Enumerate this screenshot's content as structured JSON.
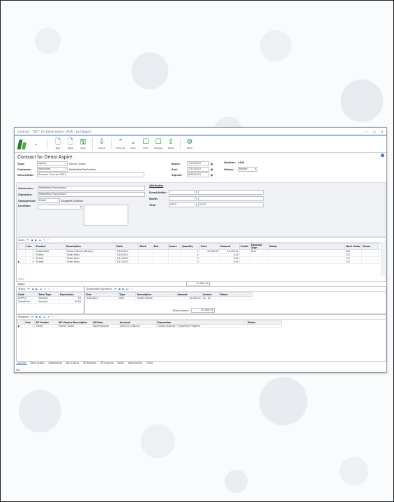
{
  "window": {
    "title": "Contract - \"007\" for Demo Aspire - ACW - Lori Bogert"
  },
  "toolbar": {
    "buttons": [
      {
        "icon": "plus-doc-icon",
        "label": "New"
      },
      {
        "icon": "doc-icon",
        "label": "Reset"
      },
      {
        "icon": "save-icon",
        "label": "Save"
      },
      {
        "icon": "import-icon",
        "label": "Import"
      },
      {
        "icon": "chevron-up-icon",
        "label": "Previous"
      },
      {
        "icon": "chevron-down-icon",
        "label": "Next"
      },
      {
        "icon": "print-icon",
        "label": "Print"
      },
      {
        "icon": "preview-icon",
        "label": "Preview"
      },
      {
        "icon": "settle-icon",
        "label": "Settle"
      },
      {
        "icon": "gear-icon",
        "label": "Stats"
      }
    ]
  },
  "contract": {
    "title": "Contract for Demo Aspire",
    "type_label": "Type:",
    "type_value": "Master",
    "subtype_value": "Interim Event",
    "customer_label": "Customer:",
    "customer_value": "MediaMax",
    "customer_value2": "MediaMax Productions",
    "description_label": "Description:",
    "description_value": "Summer Concert 2023",
    "begin_label": "Begin:",
    "begin_value": "7/10/2023",
    "end_label": "End:",
    "end_value": "7/12/2023",
    "signed_label": "Signed:",
    "signed_value": "6/30/2023",
    "number_label": "Number:",
    "number_value": "1641",
    "status_label": "Status:",
    "status_value": "Master",
    "contractor_label": "Contractor:",
    "contractor_value": "MediaMax Productions",
    "signatory_label": "Signatory:",
    "signatory_value": "MediaMax Productions",
    "salesperson_label": "Salesperson:",
    "salesperson_value": "Elliott",
    "salesperson_name": "Elizabeth Stratton",
    "location_label": "Location:",
    "attributes_label": "Attributes",
    "event_artist_label": "Event/Artist:",
    "booth_label": "Booth:",
    "year_label": "Year:",
    "year_value": "2023",
    "year_value2": "2023"
  },
  "lines": {
    "title": "Lines",
    "headers": [
      "Line",
      "Product",
      "Description",
      "Date",
      "Start",
      "End",
      "Hours",
      "Quantity",
      "Price",
      "Amount",
      "Credit",
      "Payment Type",
      "Notes",
      "Work Order",
      "Memo"
    ],
    "rows": [
      [
        "1",
        "TheatreRntl",
        "Theatre Rental (Weekly)",
        "7/10/2023",
        "",
        "",
        "",
        "1",
        "10,000.00",
        "10,000.00",
        "",
        "Rent",
        "",
        "209",
        ""
      ],
      [
        "2",
        "Tickets",
        "Ticket Sales",
        "7/10/2023",
        "",
        "",
        "",
        "0",
        "",
        "0.00",
        "",
        "",
        "",
        "210",
        ""
      ],
      [
        "3",
        "Tickets",
        "Ticket Sales",
        "7/11/2023",
        "",
        "",
        "",
        "0",
        "",
        "0.00",
        "",
        "",
        "",
        "211",
        ""
      ],
      [
        "4",
        "Tickets",
        "Ticket Sales",
        "7/12/2023",
        "",
        "",
        "",
        "0",
        "",
        "0.00",
        "",
        "",
        "",
        "212",
        ""
      ]
    ],
    "totals_label": "Totals:",
    "totals_value": "10,000.00"
  },
  "terms": {
    "title": "Terms",
    "headers": [
      "Code",
      "Data Type",
      "Expression"
    ],
    "rows": [
      [
        "BOPPCT",
        "Numeric",
        ".10"
      ],
      [
        "TicketPrice",
        "Numeric",
        "50.00"
      ]
    ]
  },
  "scheduled": {
    "title": "Scheduled Payments",
    "headers": [
      "Due",
      "Type",
      "Description",
      "Amount",
      "Invoice",
      "Memo"
    ],
    "rows": [
      [
        "3/10/2023",
        "Rent",
        "Facility Rental",
        "10,000.00",
        "10 - 42",
        ""
      ]
    ],
    "total_label": "Total Amount:",
    "total_value": "10,000.00"
  },
  "payables": {
    "title": "Payables",
    "headers": [
      "Line",
      "AP Vendor",
      "AP Vendor Description",
      "APCode",
      "Account",
      "Expression",
      "Memo"
    ],
    "rows": [
      [
        "1",
        "Tucker",
        "Rachel Tucker",
        "NonEmployee",
        "4030-01-CONCR-A",
        "Tickets.Quantity * TicketPrice * BopPct",
        ""
      ]
    ]
  },
  "bottom_tabs": [
    "Contract",
    "Work Orders",
    "Settlements",
    "AR Invoices",
    "AR Receipts",
    "AP Invoices",
    "Notes",
    "Attachments",
    "Other"
  ],
  "status": {
    "user": "DIA"
  }
}
